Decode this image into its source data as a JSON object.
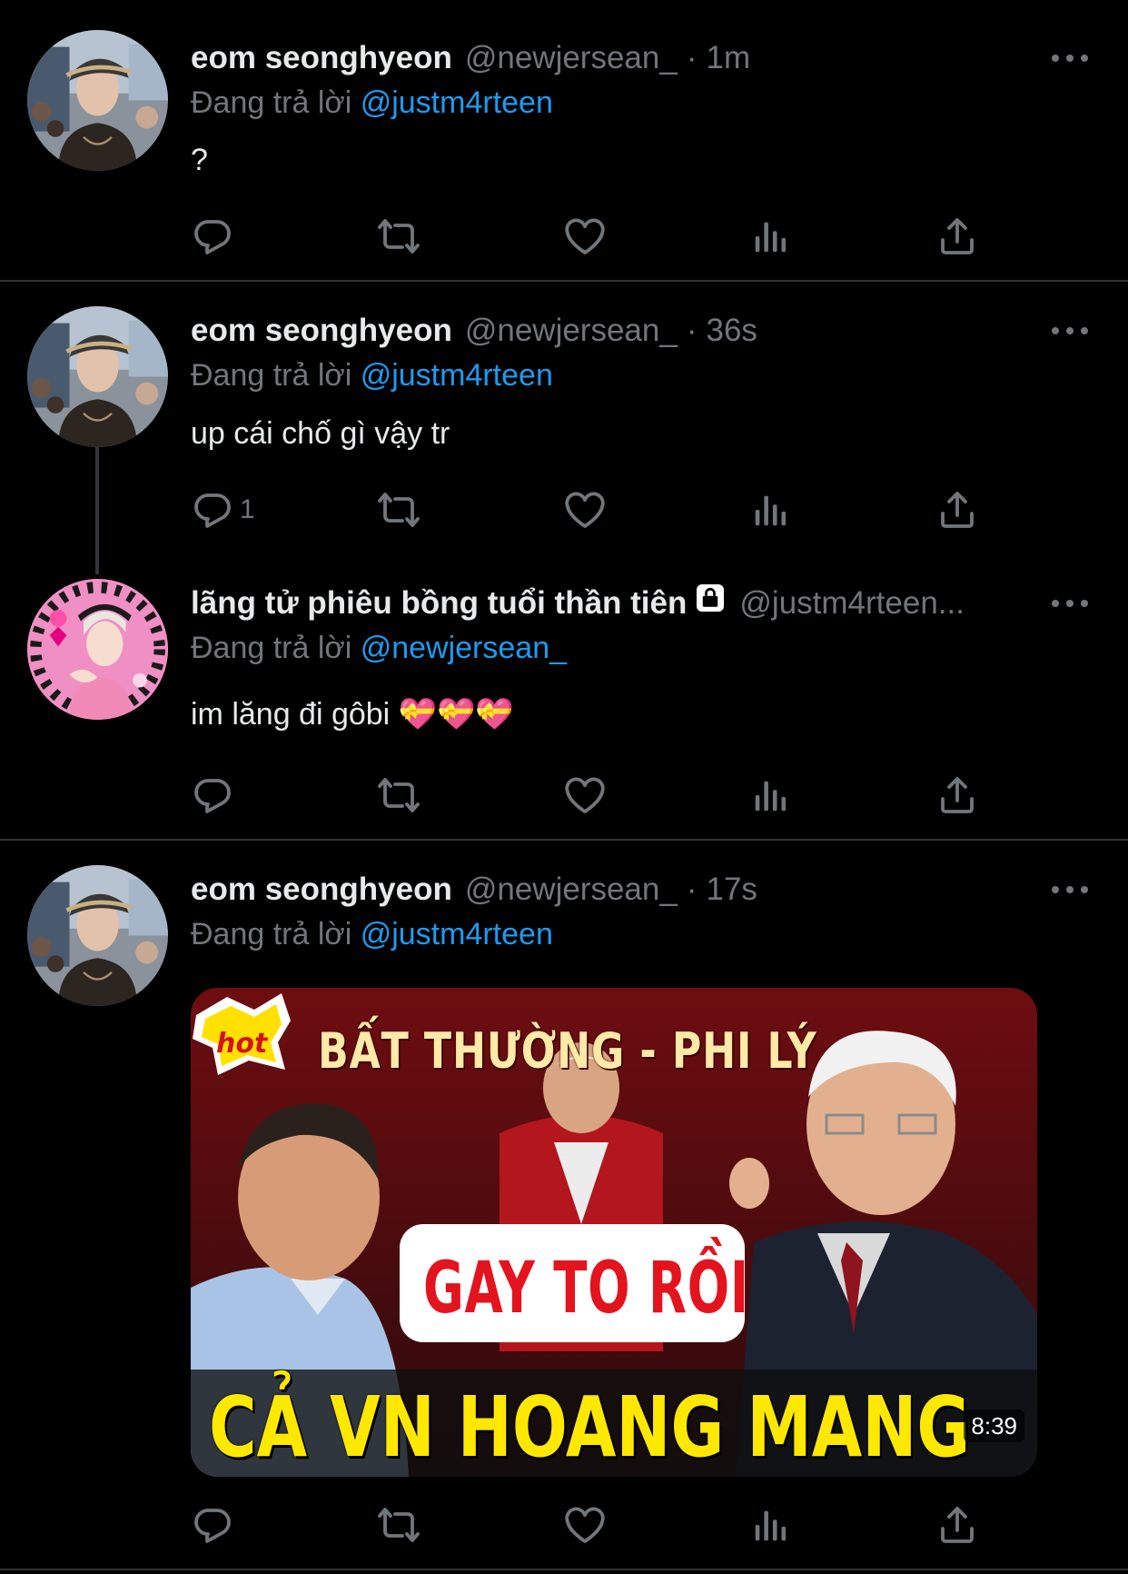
{
  "colors": {
    "background": "#000000",
    "text_primary": "#e7e9ea",
    "text_secondary": "#71767b",
    "mention": "#1d9bf0",
    "divider": "#2f3336"
  },
  "tweets": [
    {
      "name": "eom seonghyeon",
      "handle": "@newjersean_",
      "separator": "·",
      "time": "1m",
      "replying_label": "Đang trả lời ",
      "replying_to": "@justm4rteen",
      "text": "?",
      "reply_count": ""
    },
    {
      "name": "eom seonghyeon",
      "handle": "@newjersean_",
      "separator": "·",
      "time": "36s",
      "replying_label": "Đang trả lời ",
      "replying_to": "@justm4rteen",
      "text": "up cái chố gì vậy tr",
      "reply_count": "1"
    },
    {
      "name": "lãng tử phiêu bồng tuổi thần tiên",
      "handle": "@justm4rteen...",
      "protected_icon": "lock-icon",
      "replying_label": "Đang trả lời ",
      "replying_to": "@newjersean_",
      "text": "im lăng đi gôbi 💝💝💝",
      "reply_count": ""
    },
    {
      "name": "eom seonghyeon",
      "handle": "@newjersean_",
      "separator": "·",
      "time": "17s",
      "replying_label": "Đang trả lời ",
      "replying_to": "@justm4rteen",
      "reply_count": "",
      "media": {
        "badge": "hot",
        "headline_top": "BẤT THƯỜNG - PHI LÝ",
        "headline_middle": "GAY TO RỒI",
        "headline_bottom": "CẢ VN HOANG MANG",
        "duration": "8:39"
      }
    }
  ],
  "action_icons": [
    "reply-icon",
    "retweet-icon",
    "like-icon",
    "views-icon",
    "share-icon"
  ]
}
